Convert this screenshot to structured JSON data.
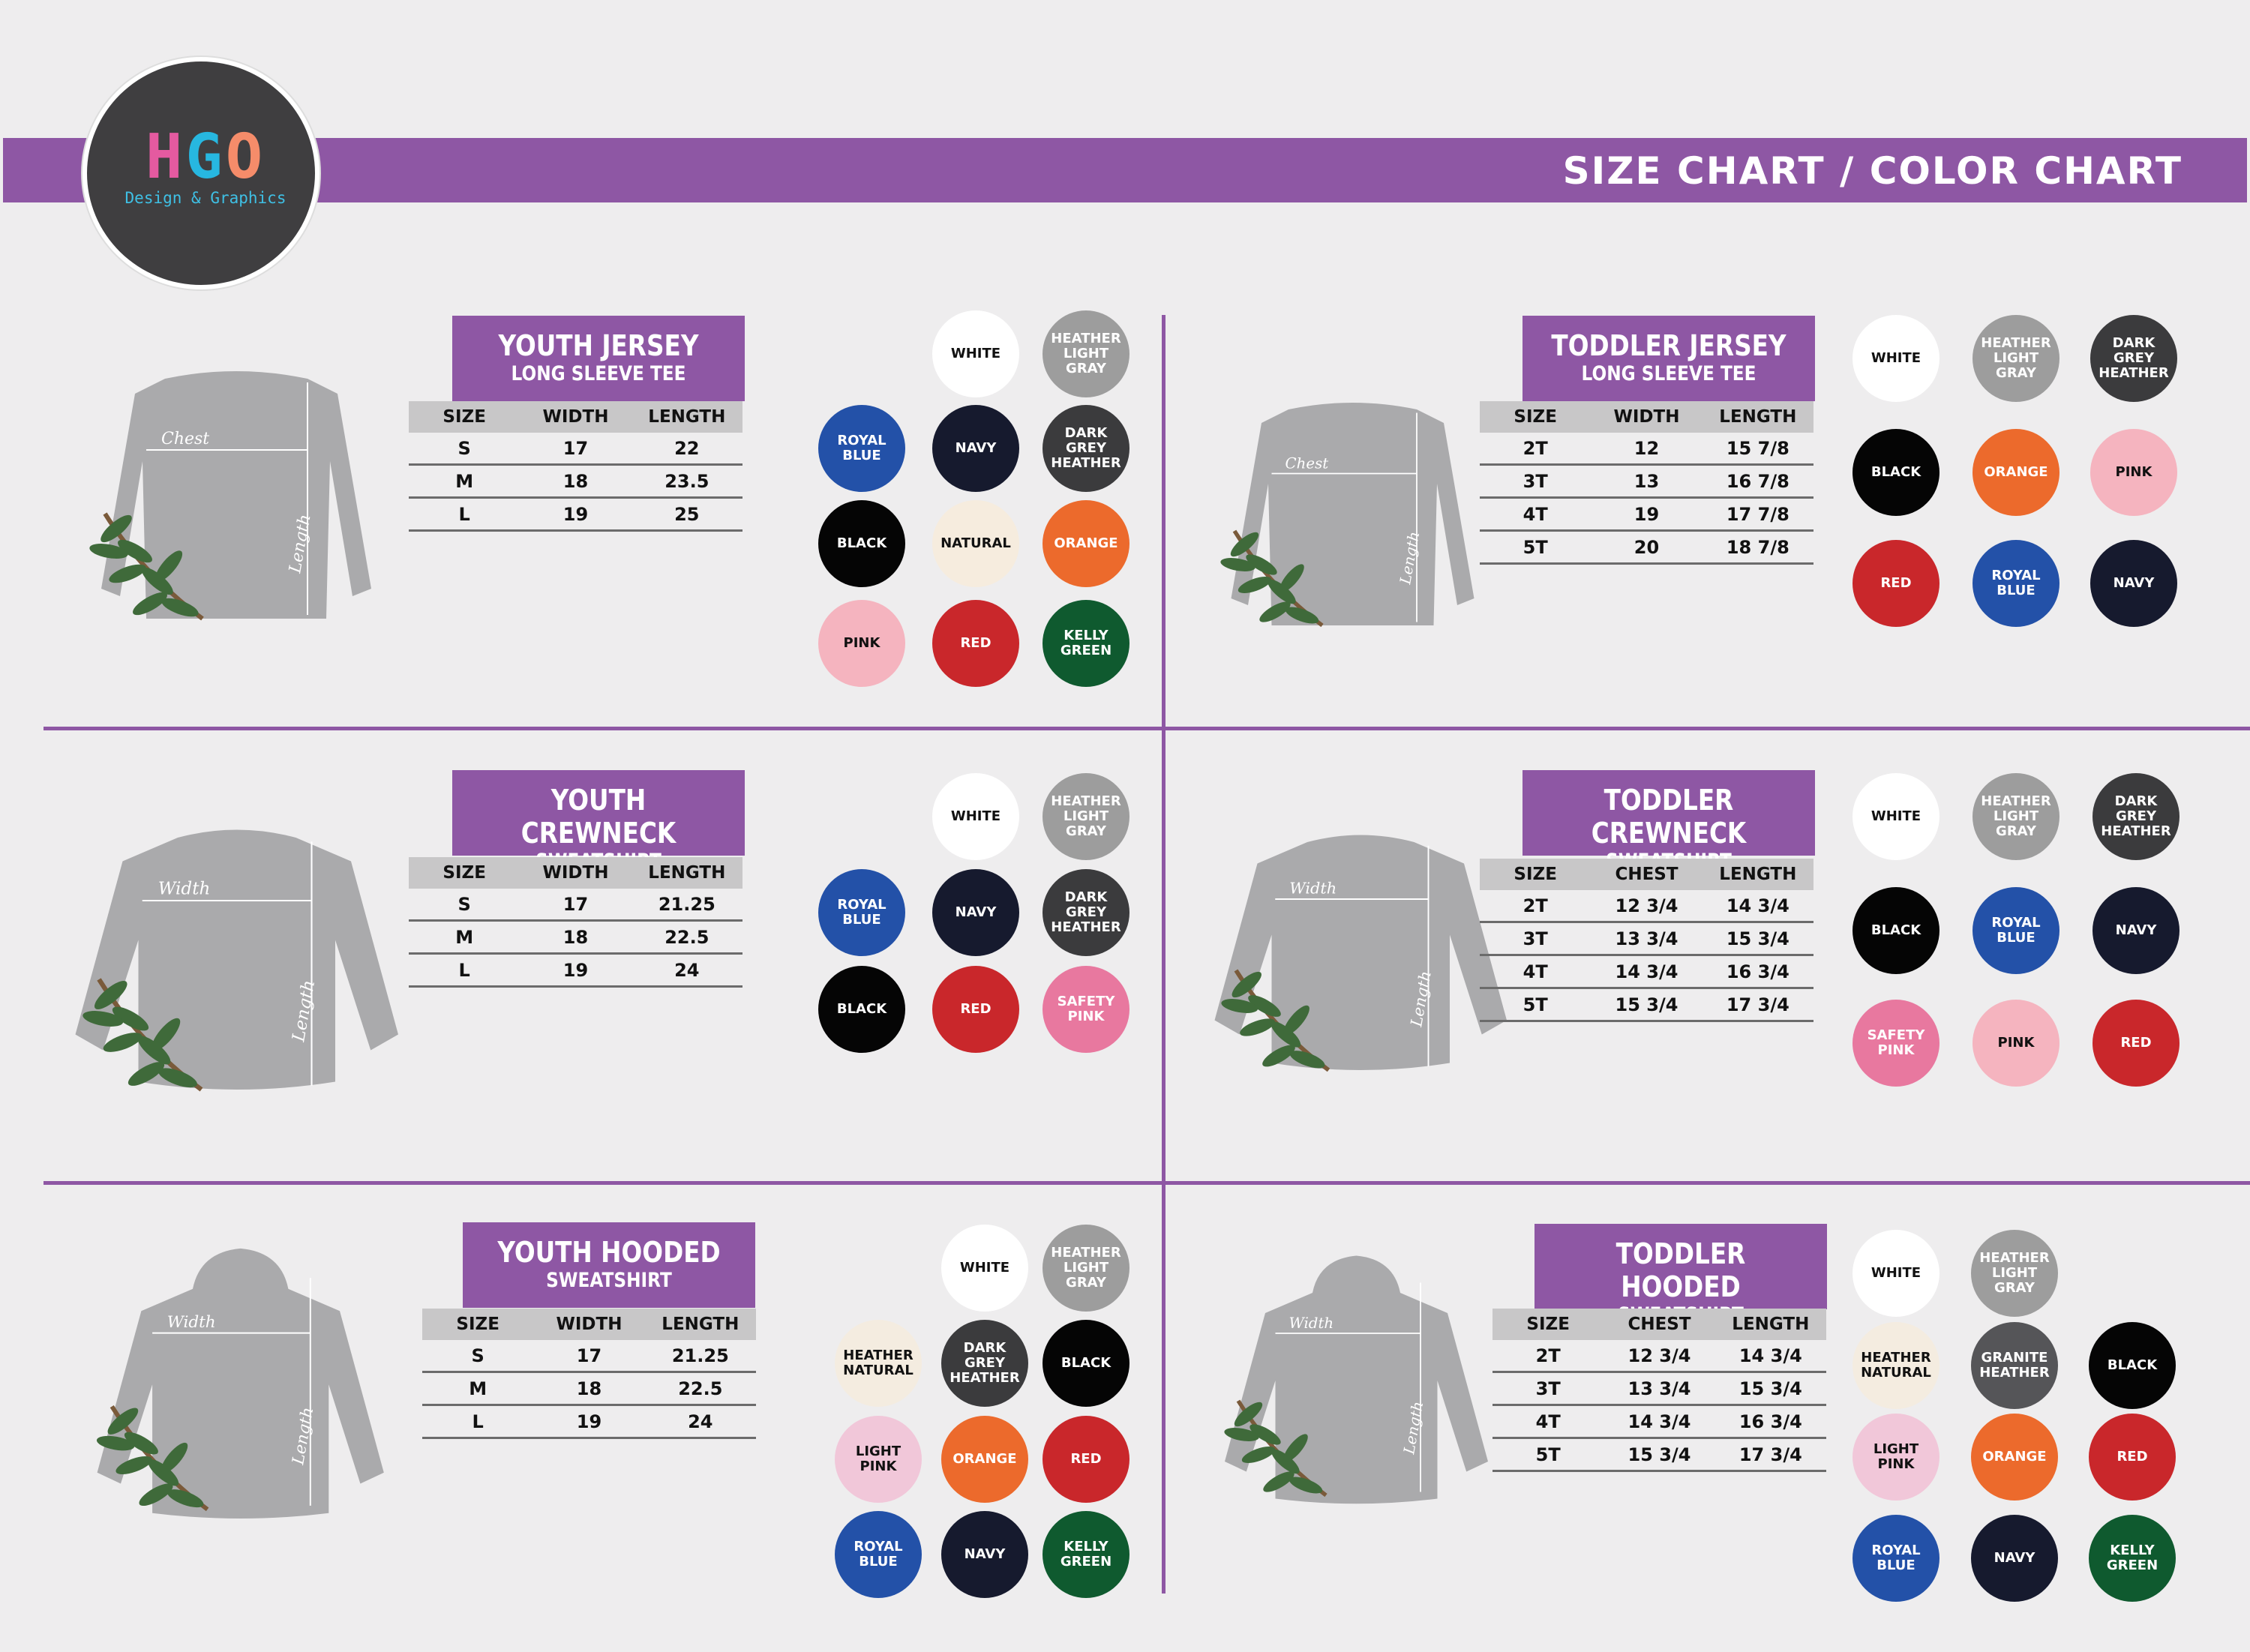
{
  "header": {
    "title": "SIZE CHART / COLOR CHART",
    "logo_mark": [
      "H",
      "G",
      "O"
    ],
    "logo_tagline": "Design & Graphics",
    "accent_color": "#8e57a4"
  },
  "garment_labels": {
    "chest": "Chest",
    "width": "Width",
    "length": "Length"
  },
  "panels": [
    {
      "title": "YOUTH JERSEY",
      "subtitle": "LONG SLEEVE TEE",
      "columns": [
        "SIZE",
        "WIDTH",
        "LENGTH"
      ],
      "rows": [
        [
          "S",
          "17",
          "22"
        ],
        [
          "M",
          "18",
          "23.5"
        ],
        [
          "L",
          "19",
          "25"
        ]
      ],
      "colors": [
        {
          "name": "WHITE",
          "hex": "#ffffff"
        },
        {
          "name": "HEATHER LIGHT GRAY",
          "hex": "#9d9d9d"
        },
        {
          "name": "ROYAL BLUE",
          "hex": "#2351a8"
        },
        {
          "name": "NAVY",
          "hex": "#161a2e"
        },
        {
          "name": "DARK GREY HEATHER",
          "hex": "#3b3b3d"
        },
        {
          "name": "BLACK",
          "hex": "#050505"
        },
        {
          "name": "NATURAL",
          "hex": "#f6ecde"
        },
        {
          "name": "ORANGE",
          "hex": "#ec6a2c"
        },
        {
          "name": "PINK",
          "hex": "#f5b4bf"
        },
        {
          "name": "RED",
          "hex": "#c9272b"
        },
        {
          "name": "KELLY GREEN",
          "hex": "#0f5a2f"
        }
      ]
    },
    {
      "title": "TODDLER JERSEY",
      "subtitle": "LONG SLEEVE TEE",
      "columns": [
        "SIZE",
        "WIDTH",
        "LENGTH"
      ],
      "rows": [
        [
          "2T",
          "12",
          "15 7/8"
        ],
        [
          "3T",
          "13",
          "16 7/8"
        ],
        [
          "4T",
          "19",
          "17 7/8"
        ],
        [
          "5T",
          "20",
          "18 7/8"
        ]
      ],
      "colors": [
        {
          "name": "WHITE",
          "hex": "#ffffff"
        },
        {
          "name": "HEATHER LIGHT GRAY",
          "hex": "#9d9d9d"
        },
        {
          "name": "DARK GREY HEATHER",
          "hex": "#3b3b3d"
        },
        {
          "name": "BLACK",
          "hex": "#050505"
        },
        {
          "name": "ORANGE",
          "hex": "#ec6a2c"
        },
        {
          "name": "PINK",
          "hex": "#f5b4bf"
        },
        {
          "name": "RED",
          "hex": "#c9272b"
        },
        {
          "name": "ROYAL BLUE",
          "hex": "#2351a8"
        },
        {
          "name": "NAVY",
          "hex": "#161a2e"
        }
      ]
    },
    {
      "title": "YOUTH CREWNECK",
      "subtitle": "SWEATSHIRT",
      "columns": [
        "SIZE",
        "WIDTH",
        "LENGTH"
      ],
      "rows": [
        [
          "S",
          "17",
          "21.25"
        ],
        [
          "M",
          "18",
          "22.5"
        ],
        [
          "L",
          "19",
          "24"
        ]
      ],
      "colors": [
        {
          "name": "WHITE",
          "hex": "#ffffff"
        },
        {
          "name": "HEATHER LIGHT GRAY",
          "hex": "#9d9d9d"
        },
        {
          "name": "ROYAL BLUE",
          "hex": "#2351a8"
        },
        {
          "name": "NAVY",
          "hex": "#161a2e"
        },
        {
          "name": "DARK GREY HEATHER",
          "hex": "#3b3b3d"
        },
        {
          "name": "BLACK",
          "hex": "#050505"
        },
        {
          "name": "RED",
          "hex": "#c9272b"
        },
        {
          "name": "SAFETY PINK",
          "hex": "#e8789f"
        }
      ]
    },
    {
      "title": "TODDLER CREWNECK",
      "subtitle": "SWEATSHIRT",
      "columns": [
        "SIZE",
        "CHEST",
        "LENGTH"
      ],
      "rows": [
        [
          "2T",
          "12 3/4",
          "14 3/4"
        ],
        [
          "3T",
          "13 3/4",
          "15 3/4"
        ],
        [
          "4T",
          "14 3/4",
          "16 3/4"
        ],
        [
          "5T",
          "15 3/4",
          "17 3/4"
        ]
      ],
      "colors": [
        {
          "name": "WHITE",
          "hex": "#ffffff"
        },
        {
          "name": "HEATHER LIGHT GRAY",
          "hex": "#9d9d9d"
        },
        {
          "name": "DARK GREY HEATHER",
          "hex": "#3b3b3d"
        },
        {
          "name": "BLACK",
          "hex": "#050505"
        },
        {
          "name": "ROYAL BLUE",
          "hex": "#2351a8"
        },
        {
          "name": "NAVY",
          "hex": "#161a2e"
        },
        {
          "name": "SAFETY PINK",
          "hex": "#e8789f"
        },
        {
          "name": "PINK",
          "hex": "#f5b4bf"
        },
        {
          "name": "RED",
          "hex": "#c9272b"
        }
      ]
    },
    {
      "title": "YOUTH HOODED",
      "subtitle": "SWEATSHIRT",
      "columns": [
        "SIZE",
        "WIDTH",
        "LENGTH"
      ],
      "rows": [
        [
          "S",
          "17",
          "21.25"
        ],
        [
          "M",
          "18",
          "22.5"
        ],
        [
          "L",
          "19",
          "24"
        ]
      ],
      "colors": [
        {
          "name": "WHITE",
          "hex": "#ffffff"
        },
        {
          "name": "HEATHER LIGHT GRAY",
          "hex": "#9d9d9d"
        },
        {
          "name": "HEATHER NATURAL",
          "hex": "#f4ece0"
        },
        {
          "name": "DARK GREY HEATHER",
          "hex": "#3b3b3d"
        },
        {
          "name": "BLACK",
          "hex": "#050505"
        },
        {
          "name": "LIGHT PINK",
          "hex": "#f1c7d9"
        },
        {
          "name": "ORANGE",
          "hex": "#ec6a2c"
        },
        {
          "name": "RED",
          "hex": "#c9272b"
        },
        {
          "name": "ROYAL BLUE",
          "hex": "#2351a8"
        },
        {
          "name": "NAVY",
          "hex": "#161a2e"
        },
        {
          "name": "KELLY GREEN",
          "hex": "#0f5a2f"
        }
      ]
    },
    {
      "title": "TODDLER HOODED",
      "subtitle": "SWEATSHIRT",
      "columns": [
        "SIZE",
        "CHEST",
        "LENGTH"
      ],
      "rows": [
        [
          "2T",
          "12 3/4",
          "14 3/4"
        ],
        [
          "3T",
          "13 3/4",
          "15 3/4"
        ],
        [
          "4T",
          "14 3/4",
          "16 3/4"
        ],
        [
          "5T",
          "15 3/4",
          "17 3/4"
        ]
      ],
      "colors": [
        {
          "name": "WHITE",
          "hex": "#ffffff"
        },
        {
          "name": "HEATHER LIGHT GRAY",
          "hex": "#9d9d9d"
        },
        {
          "name": "HEATHER NATURAL",
          "hex": "#f4ece0"
        },
        {
          "name": "GRANITE HEATHER",
          "hex": "#555558"
        },
        {
          "name": "BLACK",
          "hex": "#050505"
        },
        {
          "name": "LIGHT PINK",
          "hex": "#f1c7d9"
        },
        {
          "name": "ORANGE",
          "hex": "#ec6a2c"
        },
        {
          "name": "RED",
          "hex": "#c9272b"
        },
        {
          "name": "ROYAL BLUE",
          "hex": "#2351a8"
        },
        {
          "name": "NAVY",
          "hex": "#161a2e"
        },
        {
          "name": "KELLY GREEN",
          "hex": "#0f5a2f"
        }
      ]
    }
  ]
}
